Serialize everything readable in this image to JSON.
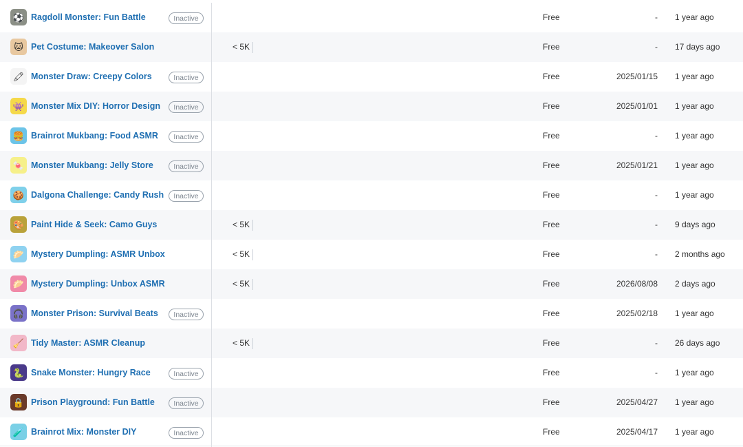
{
  "rows": [
    {
      "title": "Ragdoll Monster: Fun Battle",
      "status": "Inactive",
      "downloads": "",
      "price": "Free",
      "release": "-",
      "updated": "1 year ago",
      "icon": "ragdoll-monster-icon",
      "icon_bg": "#8b8f86",
      "glyph": "⚽"
    },
    {
      "title": "Pet Costume: Makeover Salon",
      "status": "",
      "downloads": "< 5K",
      "price": "Free",
      "release": "-",
      "updated": "17 days ago",
      "icon": "pet-costume-icon",
      "icon_bg": "#e8c8a0",
      "glyph": "🐱"
    },
    {
      "title": "Monster Draw: Creepy Colors",
      "status": "Inactive",
      "downloads": "",
      "price": "Free",
      "release": "2025/01/15",
      "updated": "1 year ago",
      "icon": "monster-draw-icon",
      "icon_bg": "#f4f4f4",
      "glyph": "🖍"
    },
    {
      "title": "Monster Mix DIY: Horror Design",
      "status": "Inactive",
      "downloads": "",
      "price": "Free",
      "release": "2025/01/01",
      "updated": "1 year ago",
      "icon": "monster-mix-icon",
      "icon_bg": "#f5d94a",
      "glyph": "👾"
    },
    {
      "title": "Brainrot Mukbang: Food ASMR",
      "status": "Inactive",
      "downloads": "",
      "price": "Free",
      "release": "-",
      "updated": "1 year ago",
      "icon": "brainrot-mukbang-icon",
      "icon_bg": "#6cc4e8",
      "glyph": "🍔"
    },
    {
      "title": "Monster Mukbang: Jelly Store",
      "status": "Inactive",
      "downloads": "",
      "price": "Free",
      "release": "2025/01/21",
      "updated": "1 year ago",
      "icon": "monster-mukbang-icon",
      "icon_bg": "#f6f08a",
      "glyph": "🍬"
    },
    {
      "title": "Dalgona Challenge: Candy Rush",
      "status": "Inactive",
      "downloads": "",
      "price": "Free",
      "release": "-",
      "updated": "1 year ago",
      "icon": "dalgona-icon",
      "icon_bg": "#7fd0ea",
      "glyph": "🍪"
    },
    {
      "title": "Paint Hide & Seek: Camo Guys",
      "status": "",
      "downloads": "< 5K",
      "price": "Free",
      "release": "-",
      "updated": "9 days ago",
      "icon": "paint-hide-seek-icon",
      "icon_bg": "#b9a23a",
      "glyph": "🎨"
    },
    {
      "title": "Mystery Dumpling: ASMR Unbox",
      "status": "",
      "downloads": "< 5K",
      "price": "Free",
      "release": "-",
      "updated": "2 months ago",
      "icon": "mystery-dumpling-icon",
      "icon_bg": "#8fd2f0",
      "glyph": "🥟"
    },
    {
      "title": "Mystery Dumpling: Unbox ASMR",
      "status": "",
      "downloads": "< 5K",
      "price": "Free",
      "release": "2026/08/08",
      "updated": "2 days ago",
      "icon": "mystery-dumpling-unbox-icon",
      "icon_bg": "#f08aa8",
      "glyph": "🥟"
    },
    {
      "title": "Monster Prison: Survival Beats",
      "status": "Inactive",
      "downloads": "",
      "price": "Free",
      "release": "2025/02/18",
      "updated": "1 year ago",
      "icon": "monster-prison-icon",
      "icon_bg": "#7a72c8",
      "glyph": "🎧"
    },
    {
      "title": "Tidy Master: ASMR Cleanup",
      "status": "",
      "downloads": "< 5K",
      "price": "Free",
      "release": "-",
      "updated": "26 days ago",
      "icon": "tidy-master-icon",
      "icon_bg": "#f2b8c8",
      "glyph": "🧹"
    },
    {
      "title": "Snake Monster: Hungry Race",
      "status": "Inactive",
      "downloads": "",
      "price": "Free",
      "release": "-",
      "updated": "1 year ago",
      "icon": "snake-monster-icon",
      "icon_bg": "#4a3a8a",
      "glyph": "🐍"
    },
    {
      "title": "Prison Playground: Fun Battle",
      "status": "Inactive",
      "downloads": "",
      "price": "Free",
      "release": "2025/04/27",
      "updated": "1 year ago",
      "icon": "prison-playground-icon",
      "icon_bg": "#6a3a2a",
      "glyph": "🔒"
    },
    {
      "title": "Brainrot Mix: Monster DIY",
      "status": "Inactive",
      "downloads": "",
      "price": "Free",
      "release": "2025/04/17",
      "updated": "1 year ago",
      "icon": "brainrot-mix-icon",
      "icon_bg": "#7ad0e6",
      "glyph": "🧪"
    }
  ]
}
